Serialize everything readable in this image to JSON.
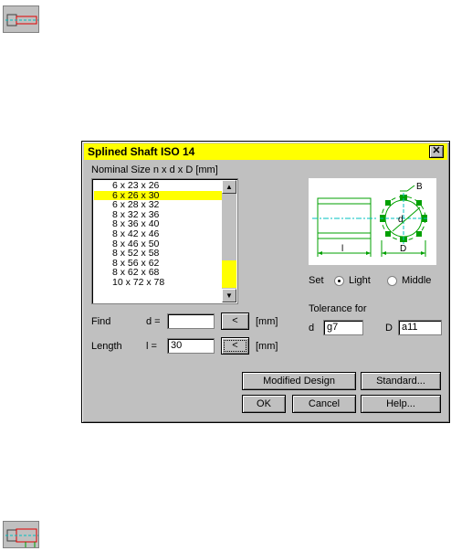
{
  "dialog": {
    "title": "Splined Shaft  ISO 14",
    "close_glyph": "✕",
    "nominal_label": "Nominal Size  n x d x D [mm]",
    "list": {
      "items": [
        "6 x 23 x 26",
        "6 x 26 x 30",
        "6 x 28 x 32",
        "8 x 32 x 36",
        "8 x 36 x 40",
        "8 x 42 x 46",
        "8 x 46 x 50",
        "8 x 52 x 58",
        "8 x 56 x 62",
        "8 x 62 x 68",
        "10 x 72 x 78"
      ],
      "selected_index": 1
    },
    "find": {
      "label": "Find",
      "param_label": "d =",
      "value": "",
      "button_label": "<",
      "unit": "[mm]"
    },
    "length": {
      "label": "Length",
      "param_label": "l =",
      "value": "30",
      "button_label": "<",
      "unit": "[mm]"
    },
    "set": {
      "label": "Set",
      "options": [
        "Light",
        "Middle"
      ],
      "selected": "Light"
    },
    "tolerance": {
      "label": "Tolerance for",
      "d_label": "d",
      "d_value": "g7",
      "D_label": "D",
      "D_value": "a11"
    },
    "buttons": {
      "modified": "Modified Design",
      "standard": "Standard...",
      "ok": "OK",
      "cancel": "Cancel",
      "help": "Help..."
    },
    "drawing_labels": {
      "B": "B",
      "d": "d",
      "l": "l",
      "D": "D"
    }
  },
  "colors": {
    "title_bar": "#ffff00",
    "selection": "#ffff00",
    "dialog_face": "#c0c0c0",
    "drawing_green": "#00a000",
    "drawing_cyan": "#00c0c0"
  },
  "icons": [
    "shaft-tool-icon",
    "shaft-tool-alt-icon"
  ]
}
